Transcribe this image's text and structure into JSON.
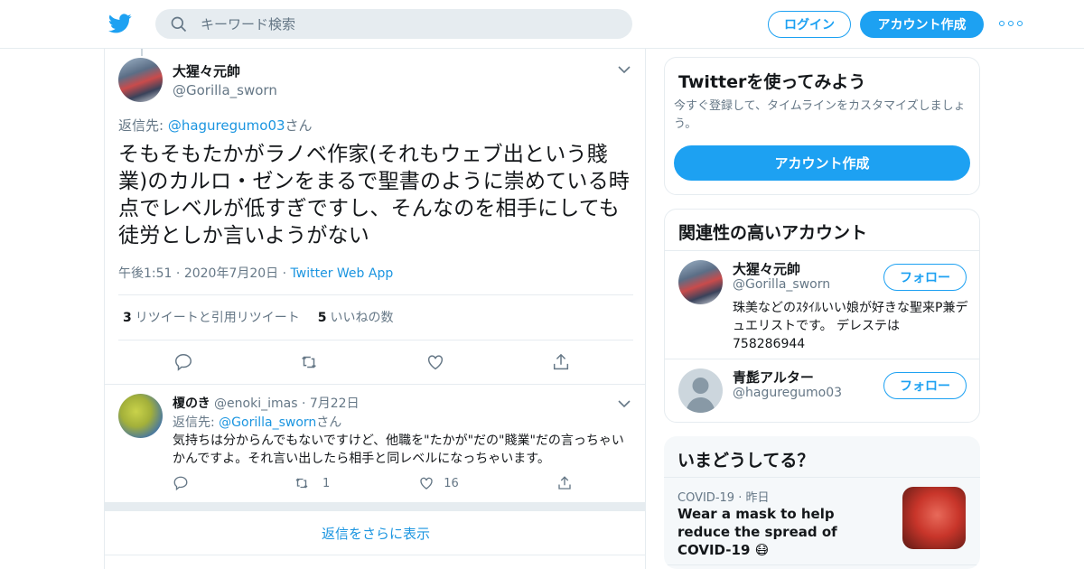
{
  "header": {
    "search_placeholder": "キーワード検索",
    "login_label": "ログイン",
    "signup_label": "アカウント作成"
  },
  "tweet": {
    "author_name": "大猩々元帥",
    "author_handle": "@Gorilla_sworn",
    "reply_prefix": "返信先: ",
    "reply_to": "@haguregumo03",
    "reply_suffix": "さん",
    "text": "そもそもたかがラノベ作家(それもウェブ出という賤業)のカルロ・ゼンをまるで聖書のように崇めている時点でレベルが低すぎですし、そんなのを相手にしても徒労としか言いようがない",
    "time": "午後1:51",
    "date": "2020年7月20日",
    "source": "Twitter Web App",
    "retweets_count": "3",
    "retweets_label": "リツイートと引用リツイート",
    "likes_count": "5",
    "likes_label": "いいねの数"
  },
  "reply": {
    "author_name": "榎のき",
    "author_handle": "@enoki_imas",
    "date": "7月22日",
    "reply_prefix": "返信先: ",
    "reply_to": "@Gorilla_sworn",
    "reply_suffix": "さん",
    "text": "気持ちは分からんでもないですけど、他職を\"たかが\"だの\"賤業\"だの言っちゃいかんですよ。それ言い出したら相手と同レベルになっちゃいます。",
    "retweets": "1",
    "likes": "16"
  },
  "show_more_label": "返信をさらに表示",
  "sidebar": {
    "signup_card": {
      "title": "Twitterを使ってみよう",
      "desc": "今すぐ登録して、タイムラインをカスタマイズしましょう。",
      "button": "アカウント作成"
    },
    "related": {
      "title": "関連性の高いアカウント",
      "follow_label": "フォロー",
      "accounts": [
        {
          "name": "大猩々元帥",
          "handle": "@Gorilla_sworn",
          "bio": "珠美などのｽﾀｲﾙいい娘が好きな聖来P兼デュエリストです。 デレステは758286944"
        },
        {
          "name": "青髭アルター",
          "handle": "@haguregumo03",
          "bio": ""
        }
      ]
    },
    "trends": {
      "title": "いまどうしてる？",
      "category": "COVID-19",
      "when": "昨日",
      "headline": "Wear a mask to help reduce the spread of COVID-19 😷"
    }
  },
  "colors": {
    "accent": "#1da1f2",
    "link": "#1b95e0",
    "muted": "#657786",
    "border": "#e6ecf0"
  },
  "icons": [
    "twitter-bird-icon",
    "search-icon",
    "more-icon",
    "chevron-down-icon",
    "reply-icon",
    "retweet-icon",
    "like-icon",
    "share-icon",
    "default-avatar-icon"
  ]
}
